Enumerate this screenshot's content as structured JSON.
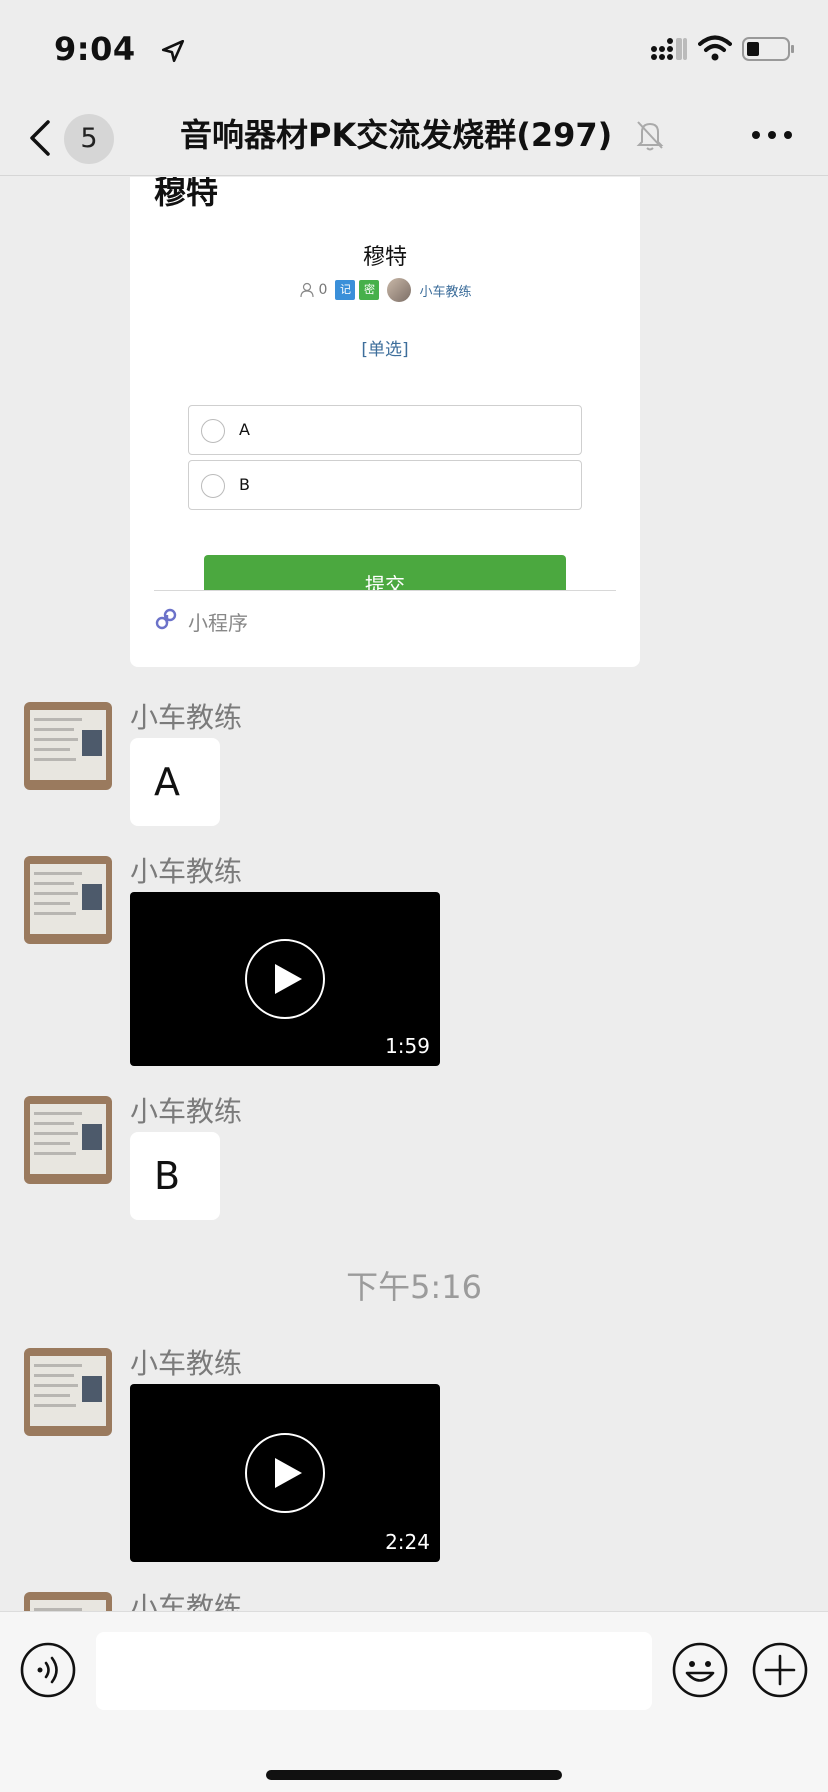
{
  "status_bar": {
    "time": "9:04"
  },
  "header": {
    "back_badge": "5",
    "title": "音响器材PK交流发烧群(297)"
  },
  "mini_program_card": {
    "title": "穆特",
    "poll": {
      "title": "穆特",
      "participant_count": "0",
      "tag_record": "记",
      "tag_secret": "密",
      "author": "小车教练",
      "type": "[单选]",
      "options": [
        "A",
        "B"
      ],
      "submit_label": "提交"
    },
    "footer_label": "小程序"
  },
  "messages": [
    {
      "sender": "小车教练",
      "type": "text",
      "text": "A"
    },
    {
      "sender": "小车教练",
      "type": "video",
      "duration": "1:59"
    },
    {
      "sender": "小车教练",
      "type": "text",
      "text": "B"
    },
    {
      "sender": "小车教练",
      "type": "video",
      "duration": "2:24"
    },
    {
      "sender": "小车教练"
    }
  ],
  "time_separator": "下午5:16",
  "input_bar": {
    "placeholder": ""
  }
}
